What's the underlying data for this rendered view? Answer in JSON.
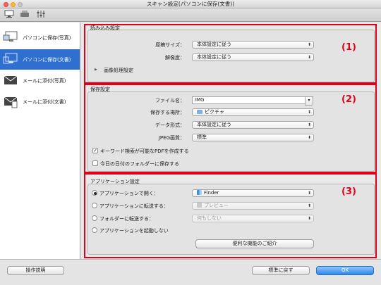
{
  "window": {
    "title": "スキャン設定(パソコンに保存(文書))"
  },
  "sidebar": {
    "items": [
      {
        "label": "パソコンに保存(写真)",
        "selected": false,
        "icon": "computer-photo-icon"
      },
      {
        "label": "パソコンに保存(文書)",
        "selected": true,
        "icon": "computer-document-icon"
      },
      {
        "label": "メールに添付(写真)",
        "selected": false,
        "icon": "mail-photo-icon"
      },
      {
        "label": "メールに添付(文書)",
        "selected": false,
        "icon": "mail-document-icon"
      }
    ]
  },
  "scan_settings": {
    "title": "読み込み設定",
    "document_size_label": "原稿サイズ：",
    "document_size_value": "本体設定に従う",
    "resolution_label": "解像度：",
    "resolution_value": "本体設定に従う",
    "image_processing_label": "画像処理設定"
  },
  "save_settings": {
    "title": "保存設定",
    "file_name_label": "ファイル名：",
    "file_name_value": "IMG",
    "save_location_label": "保存する場所：",
    "save_location_value": "ピクチャ",
    "data_format_label": "データ形式：",
    "data_format_value": "本体設定に従う",
    "jpeg_quality_label": "JPEG画質：",
    "jpeg_quality_value": "標準",
    "keyword_pdf_label": "キーワード検索が可能なPDFを作成する",
    "keyword_pdf_checked": true,
    "date_folder_label": "今日の日付のフォルダーに保存する",
    "date_folder_checked": false
  },
  "app_settings": {
    "title": "アプリケーション設定",
    "open_with_label": "アプリケーションで開く：",
    "open_with_value": "Finder",
    "send_to_app_label": "アプリケーションに転送する：",
    "send_to_app_value": "プレビュー",
    "send_to_folder_label": "フォルダーに転送する：",
    "send_to_folder_value": "何もしない",
    "do_not_start_label": "アプリケーションを起動しない",
    "useful_features_label": "便利な機能のご紹介",
    "selected_option": "open_with"
  },
  "annotations": {
    "label_1": "(1)",
    "label_2": "(2)",
    "label_3": "(3)",
    "color": "#e1001a"
  },
  "footer": {
    "instructions_label": "操作説明",
    "defaults_label": "標準に戻す",
    "ok_label": "OK"
  }
}
